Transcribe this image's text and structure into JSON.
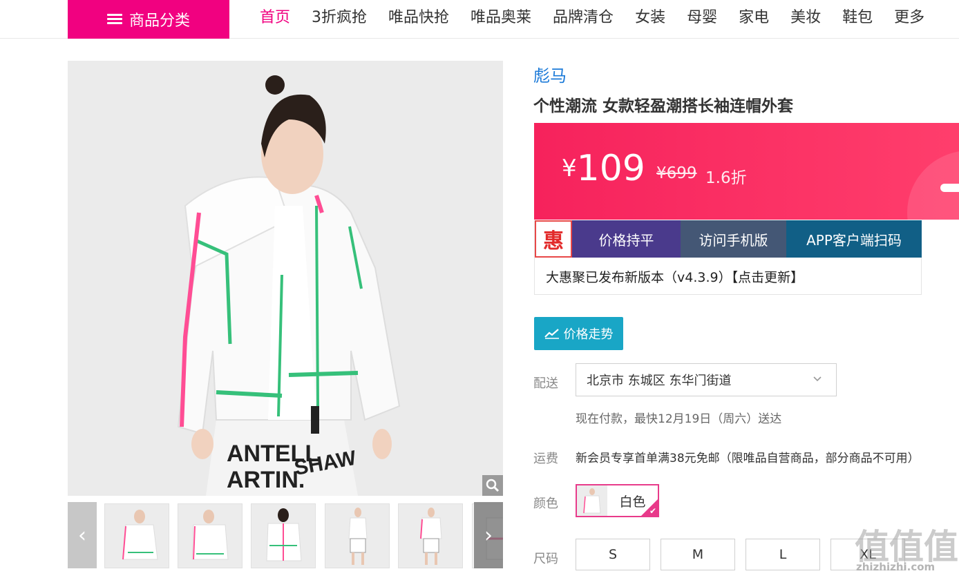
{
  "nav": {
    "category_label": "商品分类",
    "items": [
      "首页",
      "3折疯抢",
      "唯品快抢",
      "唯品奥莱",
      "品牌清仓",
      "女装",
      "母婴",
      "家电",
      "美妆",
      "鞋包",
      "更多"
    ],
    "active_index": 0,
    "accent_color": "#f10180"
  },
  "product": {
    "brand": "彪马",
    "title": "个性潮流 女款轻盈潮搭长袖连帽外套",
    "price_currency": "¥",
    "price": "109",
    "original_price": "¥699",
    "discount": "1.6折",
    "thumbnail_count": 6
  },
  "plugin": {
    "logo_char": "惠",
    "tabs": [
      "价格持平",
      "访问手机版",
      "APP客户端扫码"
    ],
    "message": "大惠聚已发布新版本（v4.3.9）【点击更新】"
  },
  "trend_button": "价格走势",
  "delivery": {
    "label": "配送",
    "address": "北京市 东城区 东华门街道",
    "note": "现在付款，最快12月19日（周六）送达"
  },
  "freight": {
    "label": "运费",
    "text": "新会员专享首单满38元免邮（限唯品自营商品，部分商品不可用）"
  },
  "color": {
    "label": "颜色",
    "selected": "白色"
  },
  "size": {
    "label": "尺码",
    "options": [
      "S",
      "M",
      "L",
      "XL"
    ]
  },
  "watermark": {
    "big": "值值值",
    "small": "zhizhizhi.com"
  }
}
